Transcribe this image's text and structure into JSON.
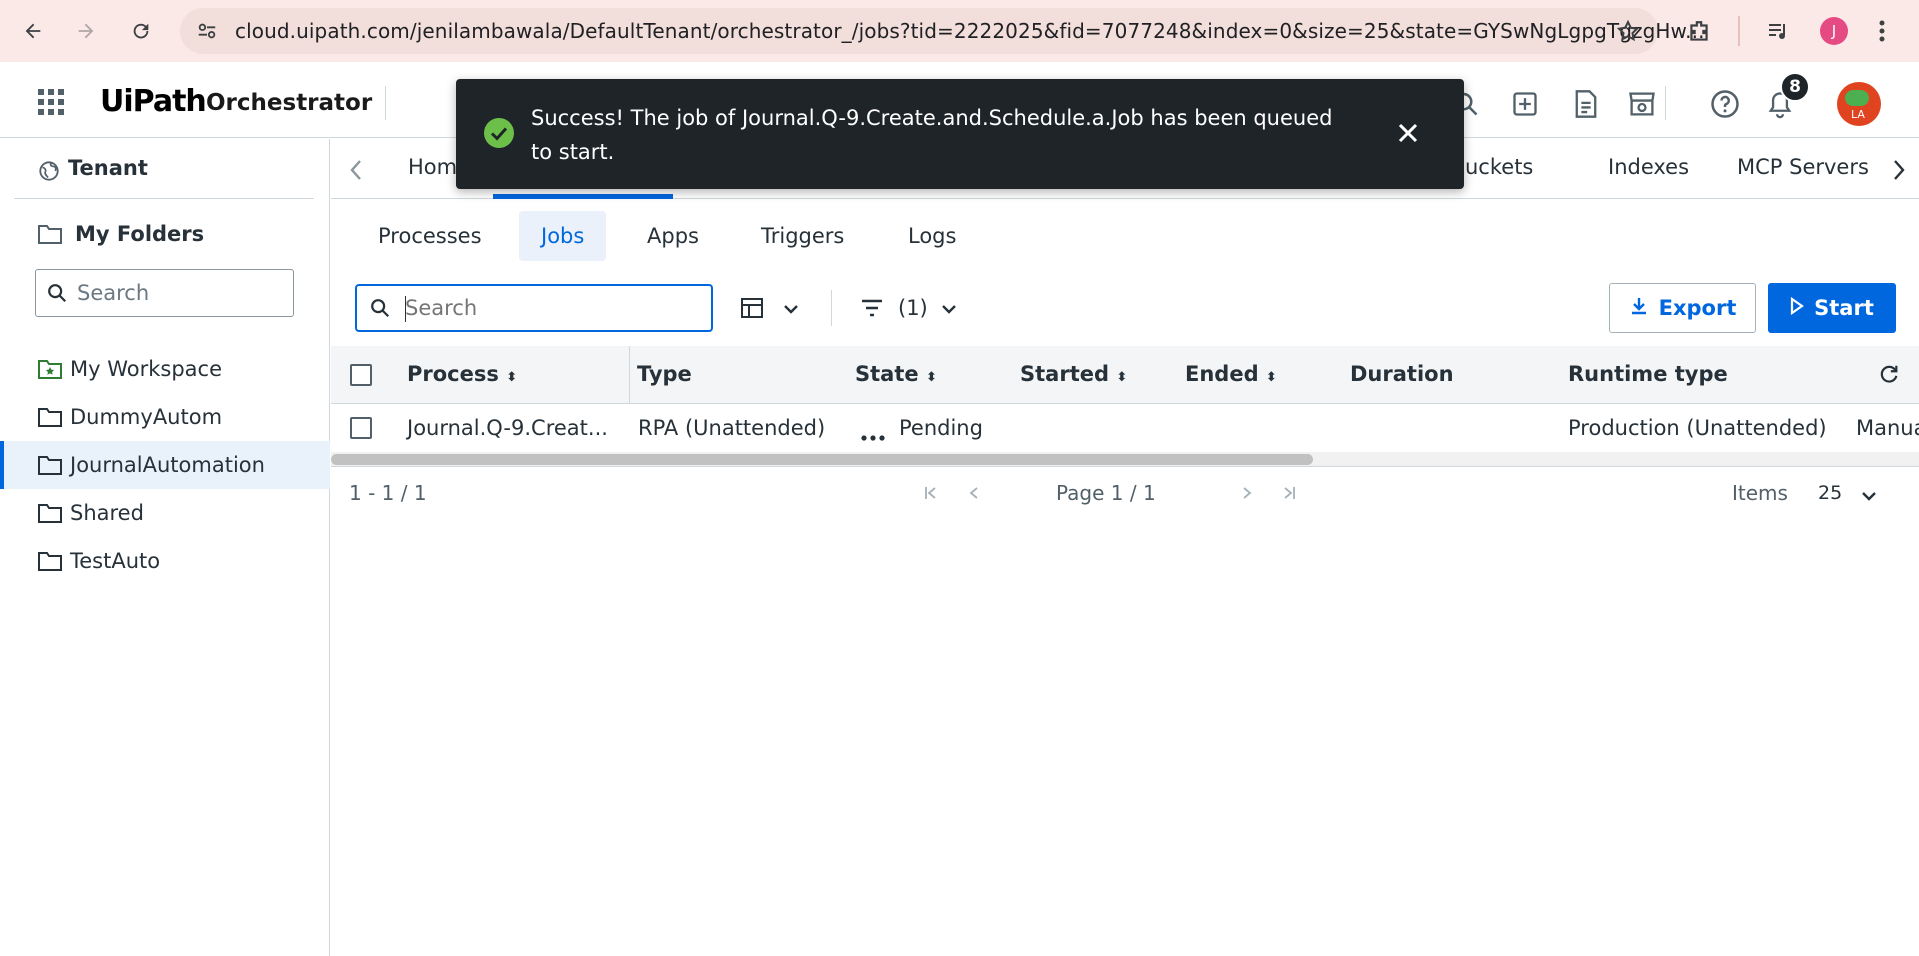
{
  "browser": {
    "url": "cloud.uipath.com/jenilambawala/DefaultTenant/orchestrator_/jobs?tid=2222025&fid=7077248&index=0&size=25&state=GYSwNgLgpgTgzgHw...",
    "profile_initial": "J"
  },
  "header": {
    "logo_ui": "UiPath",
    "product": "Orchestrator",
    "notification_count": "8",
    "avatar_initials": "LA"
  },
  "toast": {
    "message": "Success! The job of Journal.Q-9.Create.and.Schedule.a.Job has been queued to start."
  },
  "sidebar": {
    "tenant": "Tenant",
    "my_folders": "My Folders",
    "search_placeholder": "Search",
    "items": [
      {
        "label": "My Workspace"
      },
      {
        "label": "DummyAutom"
      },
      {
        "label": "JournalAutomation"
      },
      {
        "label": "Shared"
      },
      {
        "label": "TestAuto"
      }
    ]
  },
  "top_tabs": {
    "home": "Hom",
    "buckets": "e Buckets",
    "indexes": "Indexes",
    "mcp": "MCP Servers"
  },
  "sub_tabs": [
    "Processes",
    "Jobs",
    "Apps",
    "Triggers",
    "Logs"
  ],
  "toolbar": {
    "search_placeholder": "Search",
    "filter_count": "(1)",
    "export_label": "Export",
    "start_label": "Start"
  },
  "grid": {
    "columns": [
      "Process",
      "Type",
      "State",
      "Started",
      "Ended",
      "Duration",
      "Runtime type"
    ],
    "rows": [
      {
        "process": "Journal.Q-9.Creat...",
        "type": "RPA (Unattended)",
        "state": "Pending",
        "started": "",
        "ended": "",
        "duration": "",
        "runtime_type": "Production (Unattended)",
        "extra": "Manua"
      }
    ]
  },
  "footer": {
    "range": "1 - 1 / 1",
    "page": "Page 1 / 1",
    "items_label": "Items",
    "items_value": "25"
  },
  "colors": {
    "accent": "#0067df",
    "success": "#6cc04a",
    "toast_bg": "#1f2429",
    "chrome_bg": "#fbe9e7"
  }
}
